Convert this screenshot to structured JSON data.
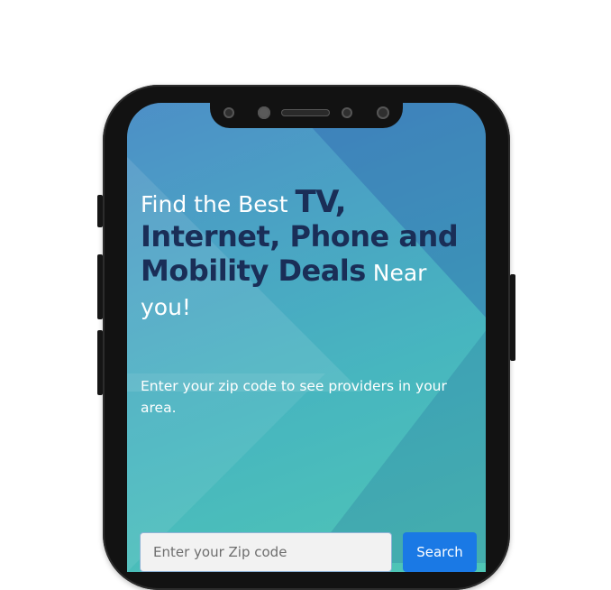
{
  "hero": {
    "heading_part1": "Find the Best ",
    "heading_part2": "TV, ",
    "heading_part3": "Internet, Phone and Mobility Deals",
    "heading_part4": " Near you!",
    "subtitle": "Enter your zip code to see providers in your area."
  },
  "search": {
    "placeholder": "Enter your Zip code",
    "value": "",
    "button_label": "Search"
  },
  "colors": {
    "accent": "#1a79e5",
    "heading_dark": "#1a2e57",
    "screen_gradient_start": "#4d8fc7",
    "screen_gradient_end": "#4fc6b5"
  }
}
